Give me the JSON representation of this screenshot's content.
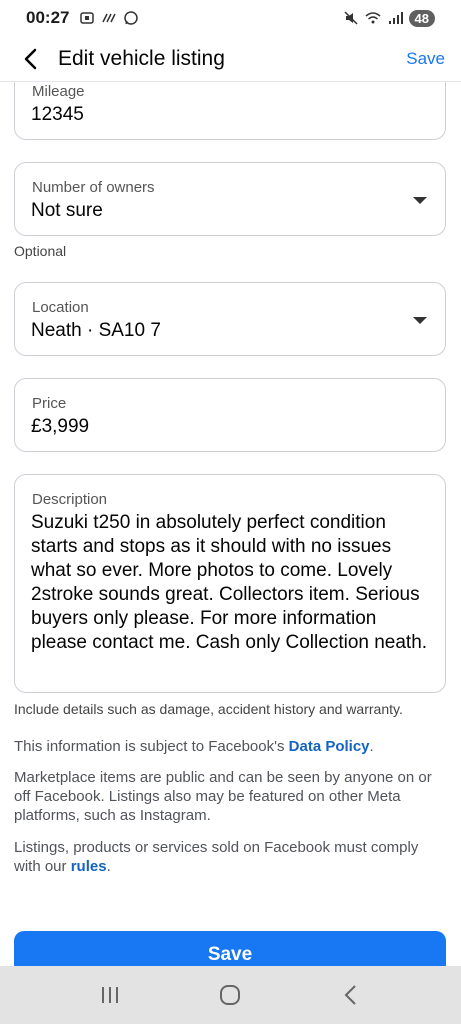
{
  "status_bar": {
    "time": "00:27",
    "battery": "48"
  },
  "header": {
    "title": "Edit vehicle listing",
    "save_label": "Save"
  },
  "mileage": {
    "label": "Mileage",
    "value": "12345"
  },
  "owners": {
    "label": "Number of owners",
    "value": "Not sure",
    "helper": "Optional"
  },
  "location": {
    "label": "Location",
    "value": "Neath · SA10 7"
  },
  "price": {
    "label": "Price",
    "value": "£3,999"
  },
  "description": {
    "label": "Description",
    "value": "Suzuki t250 in absolutely perfect condition starts and stops as it should with no issues what so ever.  More photos to come.  Lovely 2stroke sounds great.  Collectors item.  Serious buyers only please.  For more information please contact me. Cash only Collection neath.",
    "helper": "Include details such as damage, accident history and warranty."
  },
  "info": {
    "data_policy_prefix": "This information is subject to Facebook's ",
    "data_policy_link": "Data Policy",
    "data_policy_suffix": ".",
    "public_notice": "Marketplace items are public and can be seen by anyone on or off Facebook. Listings also may be featured on other Meta platforms, such as Instagram.",
    "rules_prefix": "Listings, products or services sold on Facebook must comply with our ",
    "rules_link": "rules",
    "rules_suffix": "."
  },
  "save_button": {
    "label": "Save"
  },
  "colors": {
    "accent": "#1877f2",
    "link": "#1565c0"
  },
  "nav": {
    "icons": [
      "recent-apps-icon",
      "home-icon",
      "back-icon"
    ]
  }
}
